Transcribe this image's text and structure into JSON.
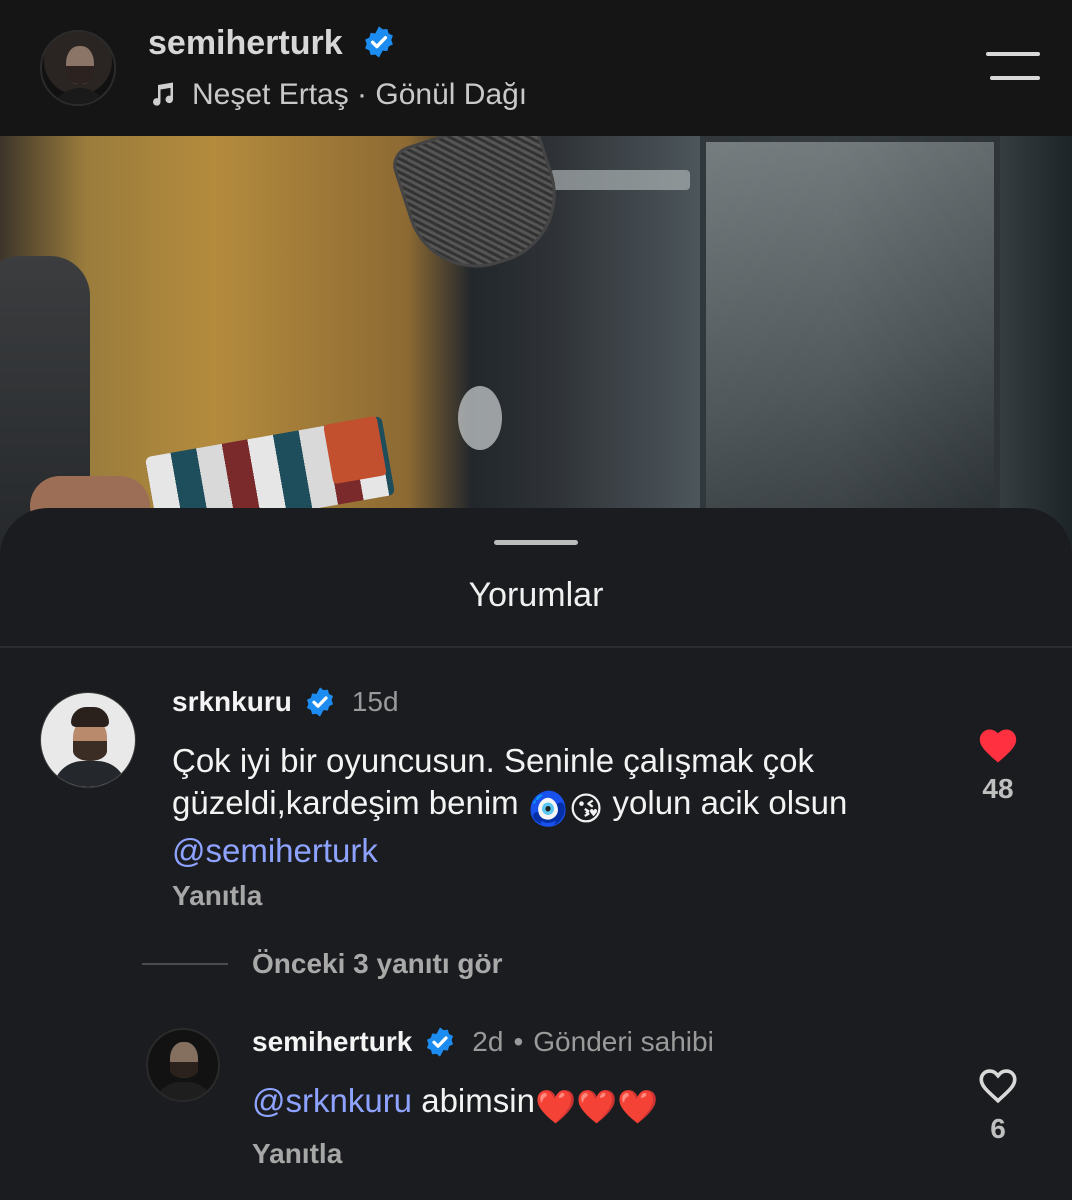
{
  "header": {
    "username": "semiherturk",
    "music": "Neşet Ertaş · Gönül Dağı"
  },
  "comments_sheet": {
    "title": "Yorumlar",
    "comment": {
      "username": "srknkuru",
      "time": "15d",
      "text_main": "Çok iyi bir oyuncusun. Seninle çalışmak çok güzeldi,kardeşim benim",
      "emoji": "🧿😘",
      "text_after": " yolun acik olsun ",
      "mention": "@semiherturk",
      "like_count": "48",
      "liked": true,
      "reply_label": "Yanıtla"
    },
    "view_replies": "Önceki 3 yanıtı gör",
    "reply": {
      "username": "semiherturk",
      "time": "2d",
      "separator": "•",
      "owner_label": "Gönderi sahibi",
      "mention": "@srknkuru",
      "text": " abimsin",
      "hearts": "❤️❤️❤️",
      "like_count": "6",
      "liked": false,
      "reply_label": "Yanıtla"
    }
  },
  "colors": {
    "background": "#1b1c1f",
    "header_bg": "#151515",
    "mention": "#8ea3ff",
    "like_red": "#ff3040",
    "verified_blue": "#1d8cf0"
  },
  "icons": [
    "music-note-icon",
    "verified-icon",
    "menu-icon",
    "heart-filled-icon",
    "heart-outline-icon"
  ]
}
